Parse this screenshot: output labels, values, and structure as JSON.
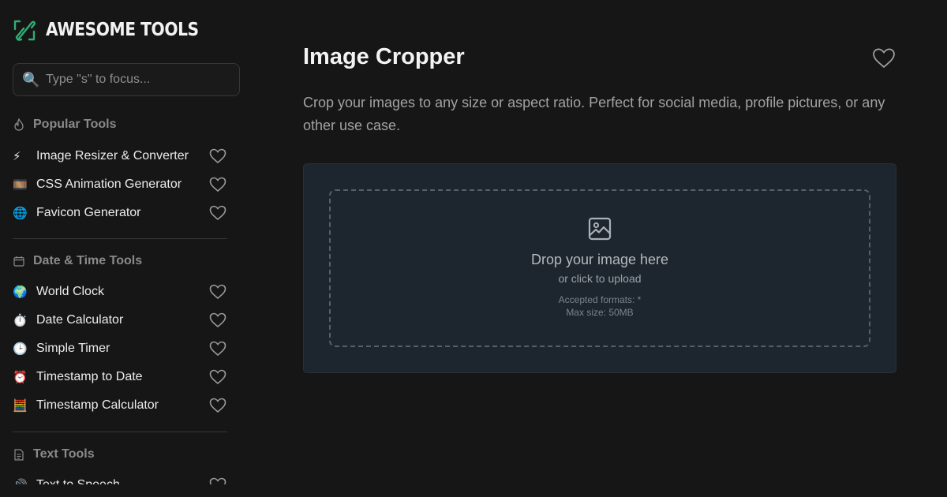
{
  "brand": {
    "name": "AWESOME TOOLS",
    "logo_icon": "link-logo-icon",
    "logo_color": "#2fae74"
  },
  "search": {
    "placeholder": "Type \"s\" to focus...",
    "icon": "magnifier-icon"
  },
  "sidebar": {
    "sections": [
      {
        "title": "Popular Tools",
        "icon": "flame-icon",
        "items": [
          {
            "label": "Image Resizer & Converter",
            "emoji": "⚡"
          },
          {
            "label": "CSS Animation Generator",
            "emoji": "🎞️"
          },
          {
            "label": "Favicon Generator",
            "emoji": "🌐"
          }
        ]
      },
      {
        "title": "Date & Time Tools",
        "icon": "calendar-icon",
        "items": [
          {
            "label": "World Clock",
            "emoji": "🌍"
          },
          {
            "label": "Date Calculator",
            "emoji": "⏱️"
          },
          {
            "label": "Simple Timer",
            "emoji": "🕒"
          },
          {
            "label": "Timestamp to Date",
            "emoji": "⏰"
          },
          {
            "label": "Timestamp Calculator",
            "emoji": "🧮"
          }
        ]
      },
      {
        "title": "Text Tools",
        "icon": "document-icon",
        "items": [
          {
            "label": "Text to Speech",
            "emoji": "🔊"
          }
        ]
      }
    ]
  },
  "main": {
    "title": "Image Cropper",
    "description": "Crop your images to any size or aspect ratio. Perfect for social media, profile pictures, or any other use case.",
    "upload": {
      "icon": "image-icon",
      "title": "Drop your image here",
      "subtitle": "or click to upload",
      "formats": "Accepted formats: *",
      "max_size": "Max size: 50MB"
    }
  },
  "colors": {
    "background": "#161616",
    "card": "#1d262e",
    "accent": "#2fae74"
  }
}
